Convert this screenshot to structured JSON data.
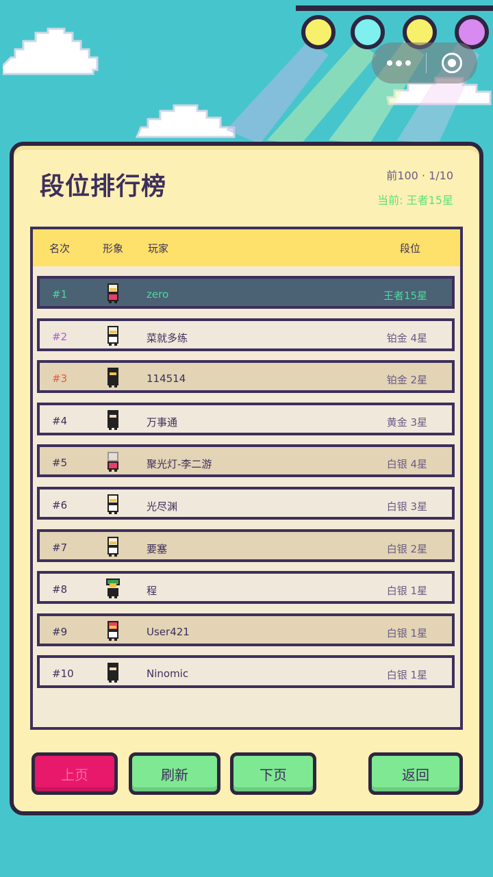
{
  "header": {
    "title": "段位排行榜",
    "range": "前100 · 1/10",
    "current": "当前: 王者15星"
  },
  "columns": {
    "rank": "名次",
    "avatar": "形象",
    "player": "玩家",
    "tier": "段位"
  },
  "rows": [
    {
      "rank": "#1",
      "name": "zero",
      "tier": "王者15星"
    },
    {
      "rank": "#2",
      "name": "菜就多练",
      "tier": "铂金 4星"
    },
    {
      "rank": "#3",
      "name": "114514",
      "tier": "铂金 2星"
    },
    {
      "rank": "#4",
      "name": "万事通",
      "tier": "黄金 3星"
    },
    {
      "rank": "#5",
      "name": "聚光灯-李二游",
      "tier": "白银 4星"
    },
    {
      "rank": "#6",
      "name": "光尽渊",
      "tier": "白银 3星"
    },
    {
      "rank": "#7",
      "name": "要塞",
      "tier": "白银 2星"
    },
    {
      "rank": "#8",
      "name": "程",
      "tier": "白银 1星"
    },
    {
      "rank": "#9",
      "name": "User421",
      "tier": "白银 1星"
    },
    {
      "rank": "#10",
      "name": "Ninomic",
      "tier": "白银 1星"
    }
  ],
  "buttons": {
    "prev": "上页",
    "refresh": "刷新",
    "next": "下页",
    "back": "返回"
  },
  "colors": {
    "background": "#46c6cc",
    "panel": "#fdf0b4",
    "outline": "#2e2540",
    "header_bar": "#fde16a",
    "highlight_row": "#4a6274",
    "accent_green": "#7fe892",
    "accent_pink": "#e8196a"
  },
  "icons": {
    "menu": "more-dots-icon",
    "close": "target-circle-icon",
    "avatar": "pixel-character-avatar"
  }
}
